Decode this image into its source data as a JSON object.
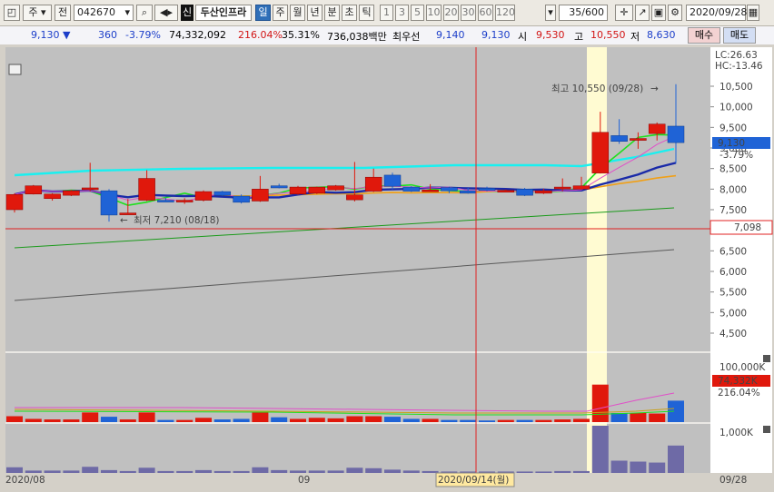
{
  "toolbar": {
    "market": "주",
    "prev": "전",
    "code": "042670",
    "badge": "신",
    "name": "두산인프라",
    "periods": [
      "일",
      "주",
      "월",
      "년",
      "분",
      "초",
      "틱"
    ],
    "active_period": "일",
    "intervals": [
      "1",
      "3",
      "5",
      "10",
      "20",
      "30",
      "60",
      "120"
    ],
    "count": "35/600",
    "date": "2020/09/28"
  },
  "quote": {
    "price": "9,130",
    "change": "360",
    "change_pct": "-3.79%",
    "volume": "74,332,092",
    "volume_ratio": "216.04%",
    "turnover": "35.31%",
    "amount": "736,038백만",
    "priority_label": "최우선",
    "ask": "9,140",
    "bid": "9,130",
    "open_label": "시",
    "open": "9,530",
    "high_label": "고",
    "high": "10,550",
    "low_label": "저",
    "low": "8,630",
    "buy_label": "매수",
    "sell_label": "매도"
  },
  "indicators": {
    "lc": "LC:26.63",
    "hc": "HC:-13.46"
  },
  "annotations": {
    "high": "최고 10,550 (09/28)",
    "low": "최저 7,210 (08/18)",
    "crosshair_date": "2020/09/14(월)",
    "crosshair_price": "7,098",
    "current_price": "9,130",
    "current_pct": "-3.79%",
    "volume_last": "74,332K",
    "volume_pct": "216.04%"
  },
  "chart_data": {
    "type": "candlestick",
    "price_ticks": [
      "10,500",
      "10,000",
      "9,500",
      "9,000",
      "8,500",
      "8,000",
      "7,500",
      "7,000",
      "6,500",
      "6,000",
      "5,500",
      "5,000",
      "4,500"
    ],
    "volume_ticks": [
      "100,000K"
    ],
    "amount_ticks": [
      "1,000K"
    ],
    "x_labels": [
      "2020/08",
      "09",
      "09/28"
    ],
    "colors": {
      "up": "#e0180c",
      "down": "#1f63d6",
      "bg": "#c0c0c0",
      "highlight": "#fffbd2"
    },
    "candles": [
      {
        "o": 7500,
        "c": 7870,
        "h": 7900,
        "l": 7430,
        "v": 11,
        "a": 12
      },
      {
        "o": 7880,
        "c": 8080,
        "h": 8100,
        "l": 7870,
        "v": 6,
        "a": 5
      },
      {
        "o": 7770,
        "c": 7880,
        "h": 7900,
        "l": 7720,
        "v": 5,
        "a": 5
      },
      {
        "o": 7850,
        "c": 7960,
        "h": 7980,
        "l": 7830,
        "v": 5,
        "a": 5
      },
      {
        "o": 8030,
        "c": 8030,
        "h": 8640,
        "l": 7950,
        "v": 18,
        "a": 13
      },
      {
        "o": 7960,
        "c": 7370,
        "h": 8000,
        "l": 7210,
        "v": 10,
        "a": 6
      },
      {
        "o": 7420,
        "c": 7420,
        "h": 7760,
        "l": 7400,
        "v": 5,
        "a": 4
      },
      {
        "o": 7730,
        "c": 8260,
        "h": 8460,
        "l": 7710,
        "v": 18,
        "a": 11
      },
      {
        "o": 7730,
        "c": 7710,
        "h": 7800,
        "l": 7690,
        "v": 4,
        "a": 4
      },
      {
        "o": 7730,
        "c": 7730,
        "h": 7780,
        "l": 7640,
        "v": 4,
        "a": 4
      },
      {
        "o": 7730,
        "c": 7940,
        "h": 7970,
        "l": 7700,
        "v": 8,
        "a": 6
      },
      {
        "o": 7940,
        "c": 7850,
        "h": 7960,
        "l": 7830,
        "v": 5,
        "a": 4
      },
      {
        "o": 7830,
        "c": 7680,
        "h": 7870,
        "l": 7650,
        "v": 6,
        "a": 4
      },
      {
        "o": 7710,
        "c": 8000,
        "h": 8320,
        "l": 7690,
        "v": 18,
        "a": 12
      },
      {
        "o": 8080,
        "c": 8030,
        "h": 8130,
        "l": 8020,
        "v": 9,
        "a": 6
      },
      {
        "o": 7880,
        "c": 8050,
        "h": 8080,
        "l": 7860,
        "v": 6,
        "a": 5
      },
      {
        "o": 7900,
        "c": 8050,
        "h": 8060,
        "l": 7880,
        "v": 8,
        "a": 5
      },
      {
        "o": 7980,
        "c": 8080,
        "h": 8100,
        "l": 7960,
        "v": 7,
        "a": 5
      },
      {
        "o": 7740,
        "c": 7860,
        "h": 8660,
        "l": 7700,
        "v": 11,
        "a": 11
      },
      {
        "o": 7950,
        "c": 8290,
        "h": 8500,
        "l": 7930,
        "v": 11,
        "a": 10
      },
      {
        "o": 8340,
        "c": 8070,
        "h": 8400,
        "l": 7990,
        "v": 10,
        "a": 7
      },
      {
        "o": 8050,
        "c": 7950,
        "h": 8070,
        "l": 7930,
        "v": 6,
        "a": 5
      },
      {
        "o": 7960,
        "c": 7980,
        "h": 8120,
        "l": 7940,
        "v": 6,
        "a": 4
      },
      {
        "o": 8040,
        "c": 7960,
        "h": 8060,
        "l": 7900,
        "v": 4,
        "a": 3
      },
      {
        "o": 7960,
        "c": 7900,
        "h": 8030,
        "l": 7890,
        "v": 4,
        "a": 3
      },
      {
        "o": 8020,
        "c": 7970,
        "h": 8060,
        "l": 7950,
        "v": 3,
        "a": 3
      },
      {
        "o": 7970,
        "c": 7970,
        "h": 7990,
        "l": 7930,
        "v": 4,
        "a": 3
      },
      {
        "o": 8000,
        "c": 7850,
        "h": 8030,
        "l": 7830,
        "v": 4,
        "a": 3
      },
      {
        "o": 7900,
        "c": 7960,
        "h": 8010,
        "l": 7880,
        "v": 4,
        "a": 3
      },
      {
        "o": 8050,
        "c": 8050,
        "h": 8260,
        "l": 7950,
        "v": 5,
        "a": 4
      },
      {
        "o": 8000,
        "c": 8080,
        "h": 8300,
        "l": 7990,
        "v": 6,
        "a": 4
      },
      {
        "o": 8390,
        "c": 9380,
        "h": 9880,
        "l": 8380,
        "v": 70,
        "a": 100
      },
      {
        "o": 9300,
        "c": 9160,
        "h": 9700,
        "l": 9100,
        "v": 17,
        "a": 26
      },
      {
        "o": 9200,
        "c": 9230,
        "h": 9380,
        "l": 8980,
        "v": 17,
        "a": 24
      },
      {
        "o": 9350,
        "c": 9580,
        "h": 9620,
        "l": 9180,
        "v": 16,
        "a": 22
      },
      {
        "o": 9530,
        "c": 9130,
        "h": 10550,
        "l": 8630,
        "v": 40,
        "a": 58
      }
    ]
  }
}
